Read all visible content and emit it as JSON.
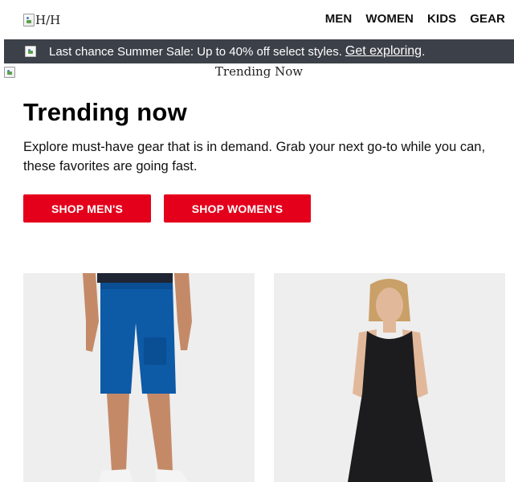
{
  "header": {
    "logo_alt": "H/H",
    "nav": [
      "MEN",
      "WOMEN",
      "KIDS",
      "GEAR"
    ]
  },
  "banner": {
    "text": "Last chance Summer Sale: Up to 40% off select styles.",
    "link": "Get exploring",
    "suffix": "."
  },
  "hero": {
    "image_alt": "Trending Now"
  },
  "main": {
    "title": "Trending now",
    "description": "Explore must-have gear that is in demand. Grab your next go-to while you can, these favorites are going fast.",
    "buttons": {
      "men": "SHOP MEN'S",
      "women": "SHOP WOMEN'S"
    }
  },
  "colors": {
    "accent": "#e4001b",
    "banner_bg": "#3c4048",
    "product_bg": "#eeeeee",
    "shorts": "#0d5aa7",
    "dress": "#1c1c1e"
  }
}
